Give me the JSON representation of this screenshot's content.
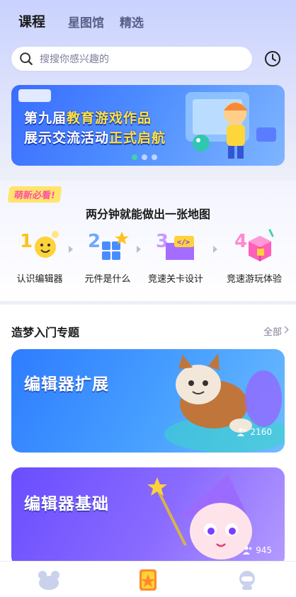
{
  "header": {
    "tabs": [
      {
        "label": "课程",
        "active": true
      },
      {
        "label": "星图馆",
        "active": false
      },
      {
        "label": "精选",
        "active": false
      }
    ]
  },
  "search": {
    "placeholder": "搜搜你感兴趣的"
  },
  "banner": {
    "line1_prefix": "第九届",
    "line1_highlight": "教育游戏作品",
    "line2_prefix": "展示交流活动",
    "line2_highlight": "正式启航",
    "active_slide": 1,
    "slide_count": 3
  },
  "newbie": {
    "tag": "萌新必看!",
    "title": "两分钟就能做出一张地图",
    "steps": [
      {
        "label": "认识编辑器",
        "icon": "smile-face-icon"
      },
      {
        "label": "元件是什么",
        "icon": "blocks-icon"
      },
      {
        "label": "竞速关卡设计",
        "icon": "code-folder-icon"
      },
      {
        "label": "竞速游玩体验",
        "icon": "cube-icon"
      }
    ]
  },
  "section": {
    "title": "造梦入门专题",
    "more_label": "全部"
  },
  "cards": [
    {
      "title": "编辑器扩展",
      "count": "2160"
    },
    {
      "title": "编辑器基础",
      "count": "945"
    }
  ],
  "bottom_nav": [
    "home-icon",
    "course-icon",
    "profile-icon"
  ],
  "colors": {
    "accent_yellow": "#ffd63a",
    "primary_blue": "#2e7cff",
    "purple": "#6a4dff"
  }
}
